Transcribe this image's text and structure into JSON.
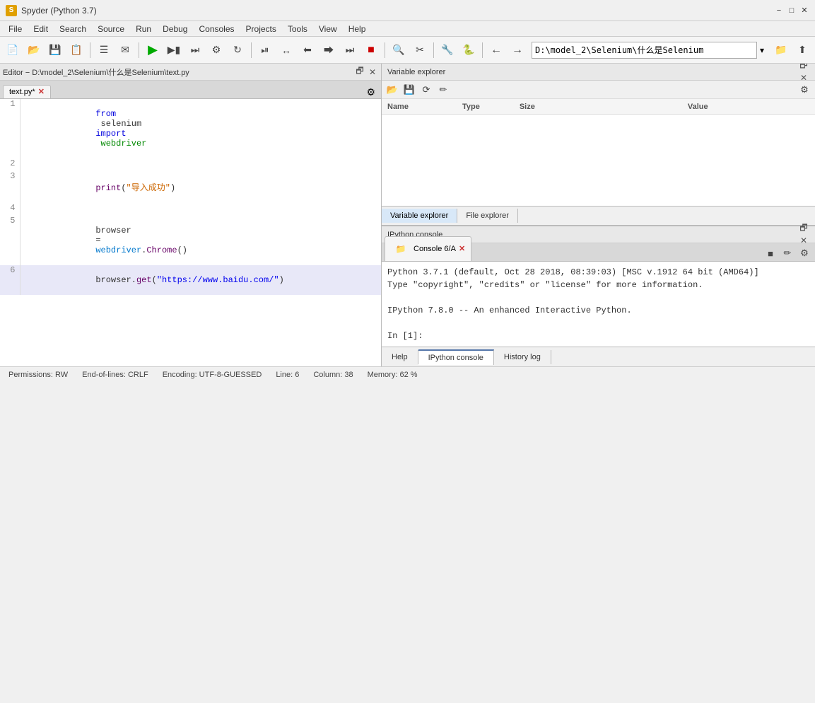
{
  "titleBar": {
    "appIcon": "S",
    "title": "Spyder (Python 3.7)",
    "minimizeLabel": "−",
    "maximizeLabel": "□",
    "closeLabel": "✕"
  },
  "menuBar": {
    "items": [
      "File",
      "Edit",
      "Search",
      "Source",
      "Run",
      "Debug",
      "Consoles",
      "Projects",
      "Tools",
      "View",
      "Help"
    ]
  },
  "toolbar": {
    "navBack": "←",
    "navForward": "→",
    "navPath": "D:\\model_2\\Selenium\\什么是Selenium",
    "navDropdown": "▾",
    "navFolder": "📁"
  },
  "editorPanel": {
    "title": "Editor − D:\\model_2\\Selenium\\什么是Selenium\\text.py",
    "tabName": "text.py*",
    "tabClose": "✕",
    "gearIcon": "⚙",
    "lines": [
      {
        "num": "1",
        "content": "from selenium import webdriver",
        "highlighted": false
      },
      {
        "num": "2",
        "content": "",
        "highlighted": false
      },
      {
        "num": "3",
        "content": "print(\"导入成功\")",
        "highlighted": false
      },
      {
        "num": "4",
        "content": "",
        "highlighted": false
      },
      {
        "num": "5",
        "content": "browser = webdriver.Chrome()",
        "highlighted": false
      },
      {
        "num": "6",
        "content": "browser.get(\"https://www.baidu.com/\")",
        "highlighted": true
      }
    ]
  },
  "varExplorer": {
    "title": "Variable explorer",
    "cols": [
      "Name",
      "Type",
      "Size",
      "Value"
    ],
    "toolbarIcons": [
      "📂",
      "💾",
      "⟳",
      "✏"
    ],
    "settingsIcon": "⚙"
  },
  "explorerTabs": {
    "tabs": [
      "Variable explorer",
      "File explorer"
    ]
  },
  "ipythonPanel": {
    "title": "IPython console",
    "tabName": "Console 6/A",
    "tabClose": "✕",
    "stopIcon": "■",
    "editIcon": "✏",
    "settingsIcon": "⚙",
    "content": {
      "line1": "Python 3.7.1 (default, Oct 28 2018, 08:39:03) [MSC v.1912 64 bit (AMD64)]",
      "line2": "Type \"copyright\", \"credits\" or \"license\" for more information.",
      "line3": "",
      "line4": "IPython 7.8.0 -- An enhanced Interactive Python.",
      "line5": "",
      "line6": "In [1]:"
    }
  },
  "bottomTabs": {
    "tabs": [
      "Help",
      "IPython console",
      "History log"
    ]
  },
  "statusBar": {
    "permissions": "Permissions: RW",
    "lineEndings": "End-of-lines: CRLF",
    "encoding": "Encoding: UTF-8-GUESSED",
    "line": "Line: 6",
    "column": "Column: 38",
    "memory": "Memory: 62 %"
  }
}
